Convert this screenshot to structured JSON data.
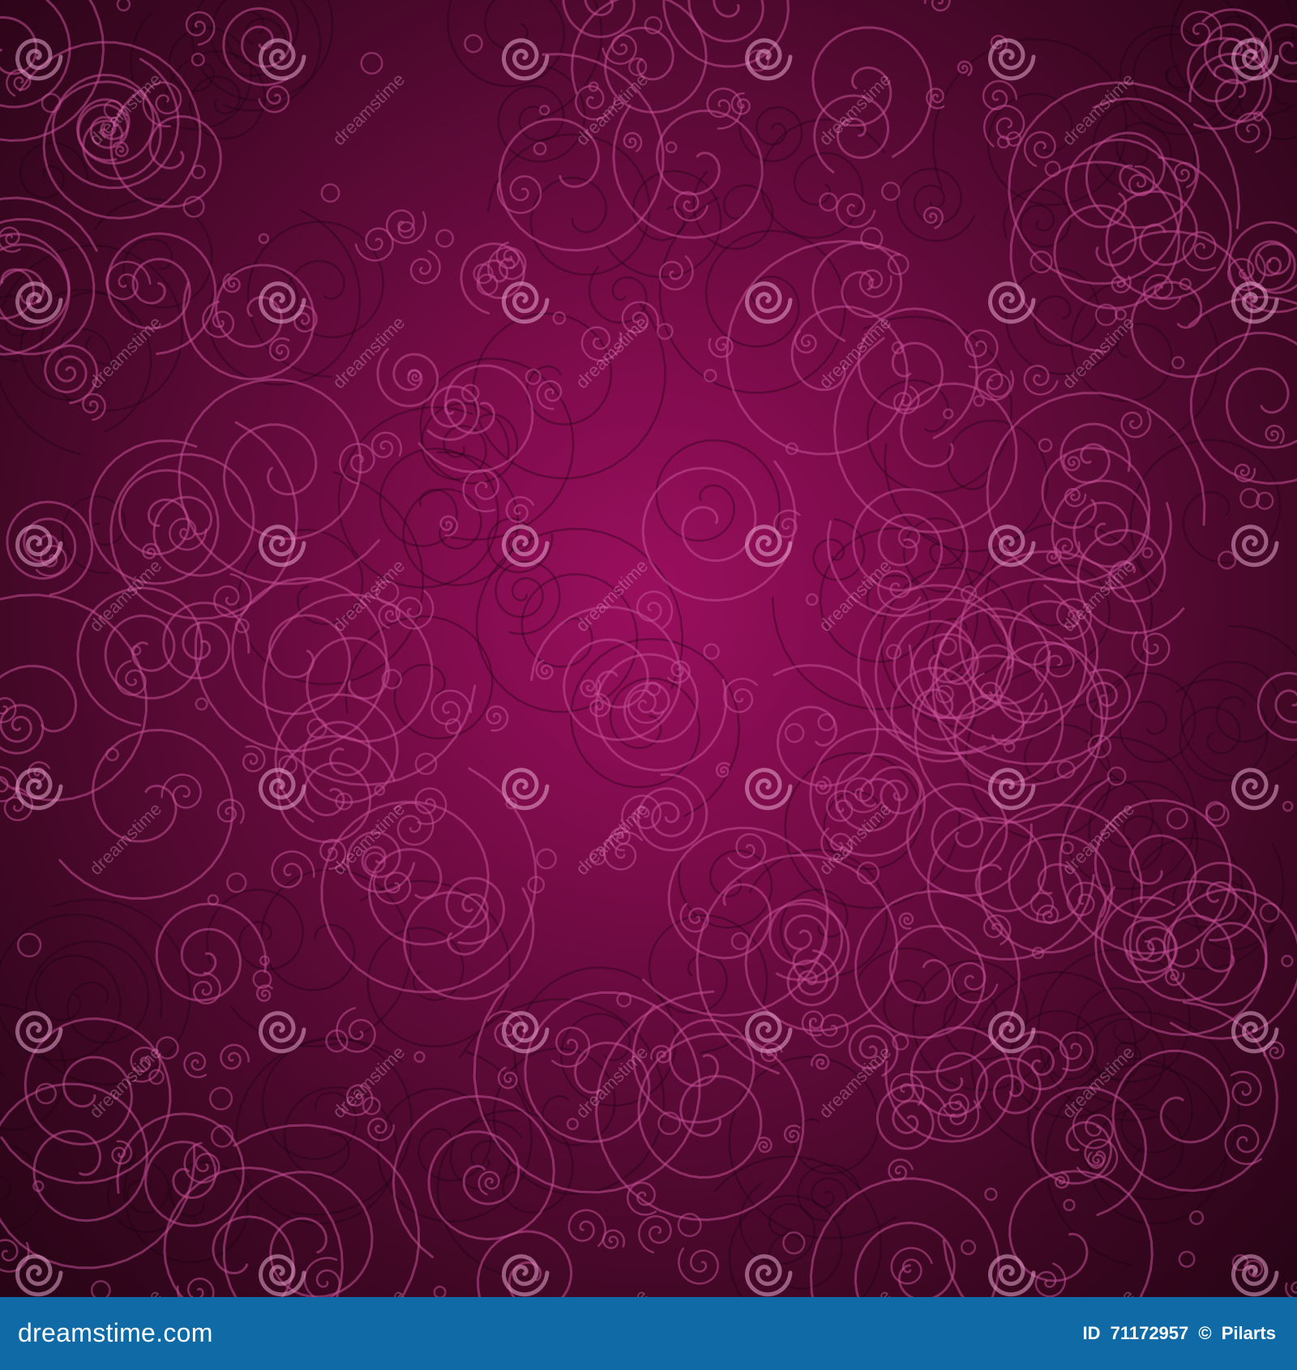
{
  "artwork": {
    "subject": "swirl-pattern",
    "colors": {
      "center": "#9a0f5e",
      "mid": "#5e0a38",
      "edge": "#260415",
      "swirl_stroke": "#c24f93",
      "shadow_stroke": "#1a0210"
    },
    "watermark_text": "dreamstime"
  },
  "footer": {
    "brand": "dreamstime.com",
    "id_label": "ID",
    "id_value": "71172957",
    "copyright_symbol": "©",
    "author": "Pilarts",
    "bar_color": "#0f6aa6"
  }
}
